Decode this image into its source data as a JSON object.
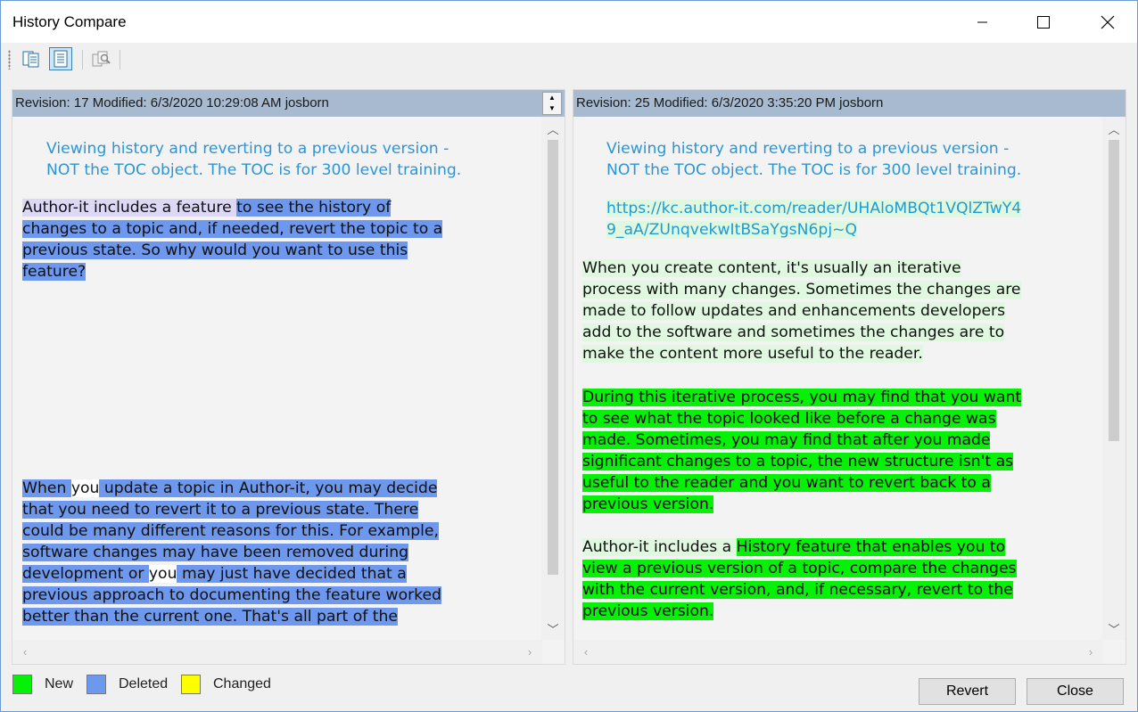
{
  "window": {
    "title": "History Compare",
    "controls": {
      "minimize": "minimize",
      "maximize": "maximize",
      "close": "close"
    }
  },
  "toolbar": {
    "tools": [
      {
        "icon": "side-by-side-view-icon",
        "active": false
      },
      {
        "icon": "document-view-icon",
        "active": true
      },
      {
        "icon": "compare-icon",
        "active": false
      }
    ]
  },
  "left_pane": {
    "header": "Revision: 17 Modified: 6/3/2020 10:29:08 AM josborn",
    "paragraphs": {
      "intro": {
        "lines": [
          "Viewing history and reverting to a previous version -",
          "NOT the TOC object. The TOC is for 300 level training."
        ]
      },
      "p1": {
        "line1_a": "Author-it includes a feature ",
        "line1_b": "to see the history of",
        "line2": "changes to a topic and, if needed, revert the topic to a",
        "line3": "previous state. So why would you want to use this",
        "line4": "feature?"
      },
      "p2": {
        "line1_a": "When ",
        "line1_b": "you",
        "line1_c": " update a topic in Author-it, you may decide",
        "line2": "that you need to revert it to a previous state. There",
        "line3": "could be many different reasons for this. For example,",
        "line4": "software changes may have been removed during",
        "line5_a": "development or ",
        "line5_b": "you",
        "line5_c": " may just have decided that a",
        "line6": "previous approach to documenting the feature worked",
        "line7": "better than the current one. That's all part of the"
      }
    }
  },
  "right_pane": {
    "header": "Revision: 25 Modified: 6/3/2020 3:35:20 PM josborn",
    "paragraphs": {
      "intro": {
        "lines": [
          "Viewing history and reverting to a previous version -",
          "NOT the TOC object. The TOC is for 300 level training."
        ]
      },
      "link": {
        "lines": [
          "https://kc.author-it.com/reader/UHAloMBQt1VQlZTwY4",
          "9_aA/ZUnqvekwItBSaYgsN6pj~Q"
        ]
      },
      "p1": {
        "lines": [
          "When you create content, it's usually an iterative",
          "process with many changes. Sometimes the changes are",
          "made to follow updates and enhancements developers",
          "add to the software and sometimes the changes are to",
          "make the content more useful to the reader."
        ]
      },
      "p2": {
        "lines": [
          "During this iterative process, you may find that you want",
          "to see what the topic looked like before a change was",
          "made. Sometimes, you may find that after you made",
          "significant changes to a topic, the new structure isn't as",
          "useful to the reader and you want to revert back to a",
          "previous version."
        ]
      },
      "p3": {
        "line1_a": "Author-it includes a ",
        "line1_b": "History feature that enables you to",
        "line2": "view a previous version of a topic, compare the changes",
        "line3": "with the current version, and, if necessary, revert to the",
        "line4": "previous version."
      }
    }
  },
  "legend": {
    "new": {
      "label": "New",
      "color": "#07f007"
    },
    "deleted": {
      "label": "Deleted",
      "color": "#6d98ee"
    },
    "changed": {
      "label": "Changed",
      "color": "#ffff00"
    }
  },
  "buttons": {
    "revert": "Revert",
    "close": "Close"
  }
}
